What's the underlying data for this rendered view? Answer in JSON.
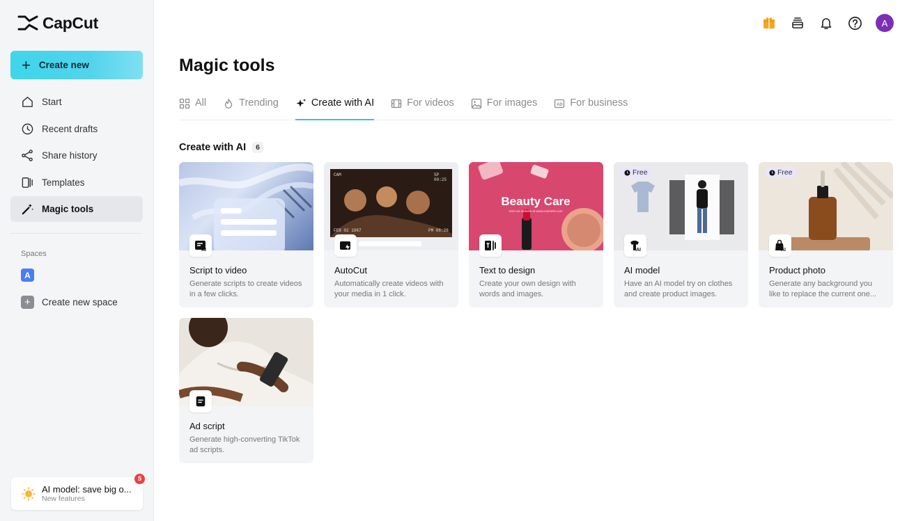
{
  "app": {
    "name": "CapCut"
  },
  "sidebar": {
    "create_label": "Create new",
    "items": [
      {
        "label": "Start",
        "icon": "home-icon"
      },
      {
        "label": "Recent drafts",
        "icon": "clock-icon"
      },
      {
        "label": "Share history",
        "icon": "share-icon"
      },
      {
        "label": "Templates",
        "icon": "templates-icon"
      },
      {
        "label": "Magic tools",
        "icon": "magic-wand-icon",
        "active": true
      }
    ],
    "spaces_title": "Spaces",
    "space_initial": "A",
    "new_space_label": "Create new space",
    "promo": {
      "title": "AI model: save big o...",
      "subtitle": "New features",
      "badge": "5"
    }
  },
  "topbar": {
    "avatar_initial": "A"
  },
  "page": {
    "title": "Magic tools",
    "tabs": [
      {
        "label": "All",
        "icon": "grid-icon"
      },
      {
        "label": "Trending",
        "icon": "flame-icon"
      },
      {
        "label": "Create with AI",
        "icon": "sparkle-icon",
        "active": true
      },
      {
        "label": "For videos",
        "icon": "film-icon"
      },
      {
        "label": "For images",
        "icon": "image-icon"
      },
      {
        "label": "For business",
        "icon": "ad-icon"
      }
    ],
    "section_title": "Create with AI",
    "section_count": "6",
    "cards": [
      {
        "name": "Script to video",
        "desc": "Generate scripts to create videos in a few clicks.",
        "icon": "script-ai-icon",
        "free": ""
      },
      {
        "name": "AutoCut",
        "desc": "Automatically create videos with your media in 1 click.",
        "icon": "autocut-icon",
        "free": "",
        "thumb_text": {
          "cam": "CAM",
          "date": "FEB 02 1987",
          "sp": "SP",
          "t1": "00:25",
          "t2": "PM 08:26"
        }
      },
      {
        "name": "Text to design",
        "desc": "Create your own design with words and images.",
        "icon": "text-design-icon",
        "free": "",
        "thumb_text": {
          "headline": "Beauty Care",
          "sub": "Visit our website at www.cosmetic.com"
        }
      },
      {
        "name": "AI model",
        "desc": "Have an AI model try on clothes and create product images.",
        "icon": "shirt-ai-icon",
        "free": "Free"
      },
      {
        "name": "Product photo",
        "desc": "Generate any background you like to replace the current one...",
        "icon": "bag-ai-icon",
        "free": "Free"
      },
      {
        "name": "Ad script",
        "desc": "Generate high-converting TikTok ad scripts.",
        "icon": "document-icon",
        "free": ""
      }
    ]
  }
}
